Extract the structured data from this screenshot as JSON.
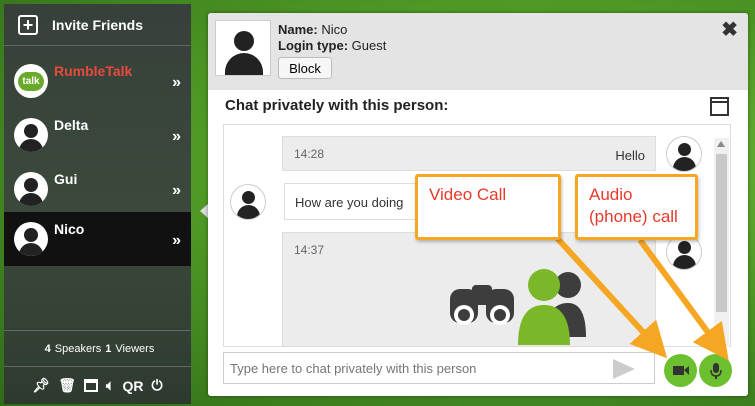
{
  "sidebar": {
    "invite_label": "Invite Friends",
    "users": [
      {
        "name": "RumbleTalk",
        "avatar_text": "talk"
      },
      {
        "name": "Delta"
      },
      {
        "name": "Gui"
      },
      {
        "name": "Nico"
      }
    ],
    "chevron": "»",
    "counts": {
      "speakers_num": "4",
      "speakers_label": "Speakers",
      "viewers_num": "1",
      "viewers_label": "Viewers"
    },
    "tools": {
      "qr": "QR"
    }
  },
  "profile": {
    "name_label": "Name:",
    "name_value": "Nico",
    "login_label": "Login type:",
    "login_value": "Guest",
    "block_label": "Block",
    "close_glyph": "✖"
  },
  "chat": {
    "title": "Chat privately with this person:",
    "messages": [
      {
        "time": "14:28",
        "text": "Hello"
      },
      {
        "time": "",
        "text": "How are you doing"
      },
      {
        "time": "14:37",
        "text": ""
      }
    ],
    "input_placeholder": "Type here to chat privately with this person"
  },
  "callouts": {
    "video": "Video Call",
    "audio_line1": "Audio",
    "audio_line2": "(phone) call"
  },
  "colors": {
    "accent_green": "#6cbf2e",
    "callout_border": "#f5a623",
    "callout_text": "#e83a2a",
    "rumbletalk_red": "#e84a3c"
  }
}
